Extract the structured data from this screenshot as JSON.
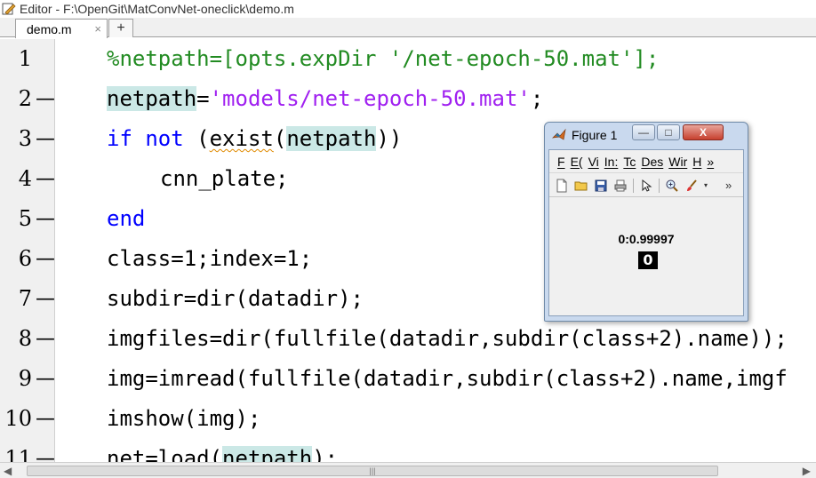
{
  "window": {
    "title": "Editor - F:\\OpenGit\\MatConvNet-oneclick\\demo.m"
  },
  "tabs": [
    {
      "label": "demo.m",
      "close": "×"
    }
  ],
  "add_tab": "+",
  "editor": {
    "lines": [
      {
        "num": "1",
        "dash": "",
        "parts": [
          {
            "t": "%netpath=[opts.expDir '/net-epoch-50.mat'];",
            "c": "cm"
          }
        ]
      },
      {
        "num": "2",
        "dash": "—",
        "parts": [
          {
            "t": "netpath",
            "c": "hl"
          },
          {
            "t": "=",
            "c": ""
          },
          {
            "t": "'models/net-epoch-50.mat'",
            "c": "str"
          },
          {
            "t": ";",
            "c": ""
          }
        ]
      },
      {
        "num": "3",
        "dash": "—",
        "parts": [
          {
            "t": "if not",
            "c": "kw"
          },
          {
            "t": " (",
            "c": ""
          },
          {
            "t": "exist",
            "c": "squig"
          },
          {
            "t": "(",
            "c": ""
          },
          {
            "t": "netpath",
            "c": "hl"
          },
          {
            "t": "))",
            "c": ""
          }
        ]
      },
      {
        "num": "4",
        "dash": "—",
        "indent": true,
        "parts": [
          {
            "t": "cnn_plate;",
            "c": ""
          }
        ]
      },
      {
        "num": "5",
        "dash": "—",
        "parts": [
          {
            "t": "end",
            "c": "kw"
          }
        ]
      },
      {
        "num": "6",
        "dash": "—",
        "parts": [
          {
            "t": "class=1;index=1;",
            "c": ""
          }
        ]
      },
      {
        "num": "7",
        "dash": "—",
        "parts": [
          {
            "t": "subdir=dir(datadir);",
            "c": ""
          }
        ]
      },
      {
        "num": "8",
        "dash": "—",
        "parts": [
          {
            "t": "imgfiles=dir(fullfile(datadir,subdir(class+2).name));",
            "c": ""
          }
        ]
      },
      {
        "num": "9",
        "dash": "—",
        "parts": [
          {
            "t": "img=imread(fullfile(datadir,subdir(class+2).name,imgf",
            "c": ""
          }
        ]
      },
      {
        "num": "10",
        "dash": "—",
        "parts": [
          {
            "t": "imshow(img);",
            "c": ""
          }
        ]
      },
      {
        "num": "11",
        "dash": "—",
        "parts": [
          {
            "t": "net=load(",
            "c": ""
          },
          {
            "t": "netpath",
            "c": "hl"
          },
          {
            "t": ");",
            "c": ""
          }
        ]
      }
    ]
  },
  "scrollbar": {
    "grip": "|||"
  },
  "figure": {
    "title": "Figure 1",
    "buttons": {
      "minimize": "—",
      "maximize": "□",
      "close": "X"
    },
    "menu": [
      "F",
      "E(",
      "Vi",
      "In:",
      "Tc",
      "Des",
      "Wir",
      "H",
      "»"
    ],
    "toolbar_icons": [
      "new-file-icon",
      "open-folder-icon",
      "save-icon",
      "print-icon",
      "pointer-icon",
      "zoom-in-icon",
      "brush-icon"
    ],
    "toolbar_more": "»",
    "label": "0:0.99997",
    "image_text": "0"
  },
  "colors": {
    "keyword": "#0000ff",
    "comment": "#228b22",
    "string": "#a020f0",
    "highlight": "#cbe8e6"
  }
}
